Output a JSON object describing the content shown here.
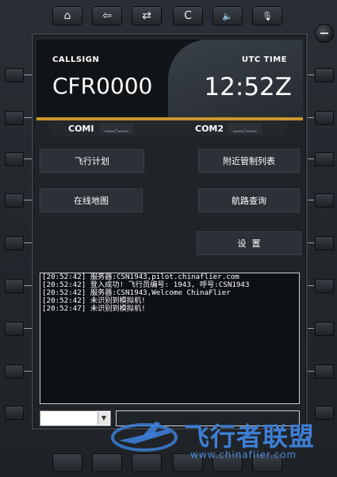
{
  "toolbar": {
    "home_glyph": "⌂",
    "back_glyph": "⇦",
    "swap_glyph": "⇄",
    "clear_label": "C",
    "speaker_glyph": "🔈",
    "mic_glyph": "🎙"
  },
  "header": {
    "callsign_label": "CALLSIGN",
    "callsign_value": "CFR0000",
    "utc_label": "UTC TIME",
    "utc_value": "12:52Z"
  },
  "com": {
    "com1_label": "COMI",
    "com1_value": "___.___",
    "com2_label": "COM2",
    "com2_value": "___.___"
  },
  "menu": {
    "flight_plan": "飞行计划",
    "nearby_atc": "附近管制列表",
    "online_map": "在线地图",
    "route_query": "航路查询",
    "settings": "设  置"
  },
  "log": [
    "[20:52:42] 服务器:CSN1943,pilot.chinaflier.com",
    "[20:52:42] 登入成功! 飞行员编号: 1943, 呼号:CSN1943",
    "[20:52:42] 服务器:CSN1943,Welcome ChinaFlier",
    "[20:52:42] 未识别到模拟机!",
    "[20:52:47] 未识别到模拟机!"
  ],
  "input": {
    "combo_value": "",
    "combo_arrow": "▼",
    "message_value": ""
  },
  "watermark": {
    "title": "飞行者联盟",
    "url": "www.chinaflier.com"
  },
  "colors": {
    "accent_gold": "#c9962e",
    "watermark_blue": "#3d7fd6"
  }
}
